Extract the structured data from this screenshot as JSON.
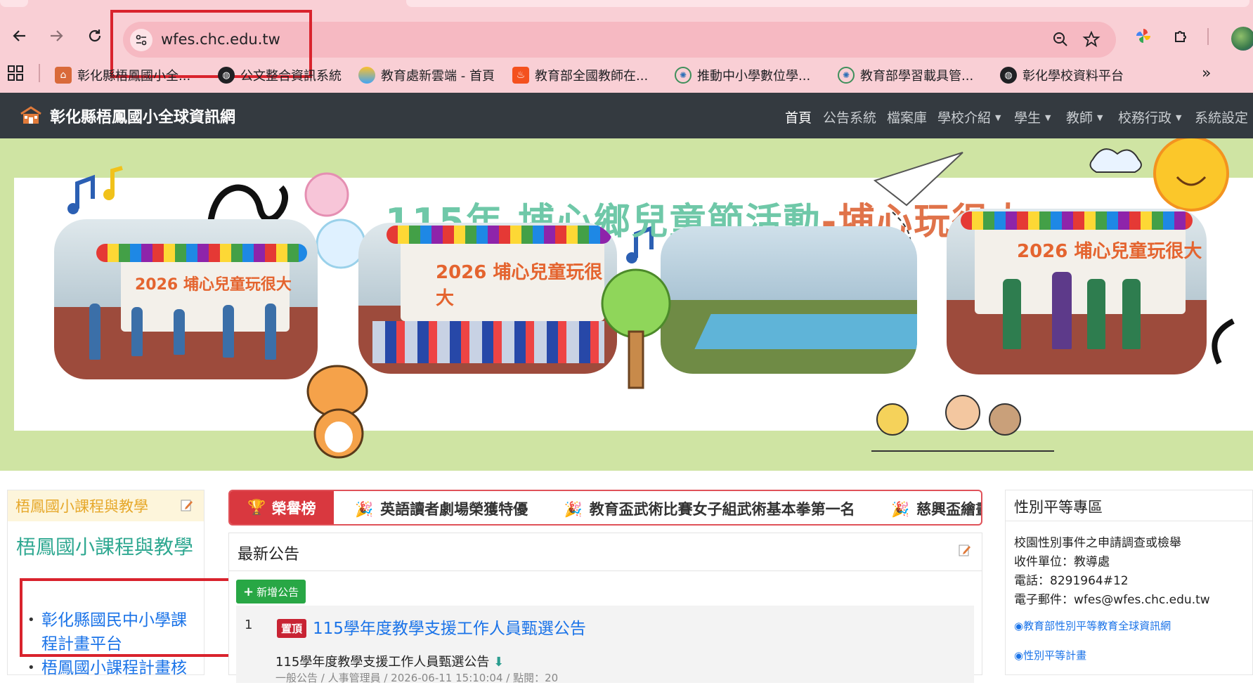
{
  "browser": {
    "url": "wfes.chc.edu.tw",
    "bookmarks": [
      {
        "label": "彰化縣梧鳳國小全...",
        "icon": "school-icon"
      },
      {
        "label": "公文整合資訊系統",
        "icon": "globe-icon"
      },
      {
        "label": "教育處新雲端 - 首頁",
        "icon": "cloud-icon"
      },
      {
        "label": "教育部全國教師在...",
        "icon": "flame-icon"
      },
      {
        "label": "推動中小學數位學...",
        "icon": "emblem-icon"
      },
      {
        "label": "教育部學習載具管...",
        "icon": "emblem-icon"
      },
      {
        "label": "彰化學校資料平台",
        "icon": "globe-icon"
      }
    ],
    "more_label": "»"
  },
  "site": {
    "title": "彰化縣梧鳳國小全球資訊網",
    "nav": [
      {
        "label": "首頁",
        "dropdown": false,
        "active": true
      },
      {
        "label": "公告系統",
        "dropdown": false,
        "active": false
      },
      {
        "label": "檔案庫",
        "dropdown": false,
        "active": false
      },
      {
        "label": "學校介紹",
        "dropdown": true,
        "active": false
      },
      {
        "label": "學生",
        "dropdown": true,
        "active": false
      },
      {
        "label": "教師",
        "dropdown": true,
        "active": false
      },
      {
        "label": "校務行政",
        "dropdown": true,
        "active": false
      },
      {
        "label": "系統設定",
        "dropdown": false,
        "active": false
      }
    ]
  },
  "banner": {
    "title_main": "115年 埔心鄉兒童節活動",
    "title_highlight": "-埔心玩很大",
    "photo1_text": "2026 埔心兒童玩很大",
    "photo2_text": "2026 埔心兒童玩很大",
    "photo4_text": "2026 埔心兒童玩很大",
    "slides": 11,
    "active_slide": 1
  },
  "left_panel": {
    "header": "梧鳳國小課程與教學",
    "title": "梧鳳國小課程與教學",
    "links": [
      "彰化縣國民中小學課程計畫平台",
      "梧鳳國小課程計畫核"
    ]
  },
  "honor": {
    "label": "榮譽榜",
    "items": [
      "英語讀者劇場榮獲特優",
      "教育盃武術比賽女子組武術基本拳第一名",
      "慈興盃繪畫比賽"
    ]
  },
  "news": {
    "header": "最新公告",
    "add_label": "新增公告",
    "rows": [
      {
        "num": "1",
        "pin": "置頂",
        "title": "115學年度教學支援工作人員甄選公告",
        "subtitle": "115學年度教學支援工作人員甄選公告",
        "meta": "一般公告 / 人事管理員 / 2026-06-11 15:10:04 / 點閱：20"
      }
    ]
  },
  "right_panel": {
    "header": "性別平等專區",
    "lines": [
      "校園性別事件之申請調查或檢舉",
      "收件單位：教導處",
      "電話：8291964#12",
      "電子郵件：wfes@wfes.chc.edu.tw"
    ],
    "links": [
      "教育部性別平等教育全球資訊網",
      "性別平等計畫"
    ]
  },
  "colors": {
    "nav_bg": "#343a40",
    "banner_bg": "#cfe4a3",
    "chrome_bg": "#f9cfd5",
    "annotation_red": "#d9232d"
  }
}
